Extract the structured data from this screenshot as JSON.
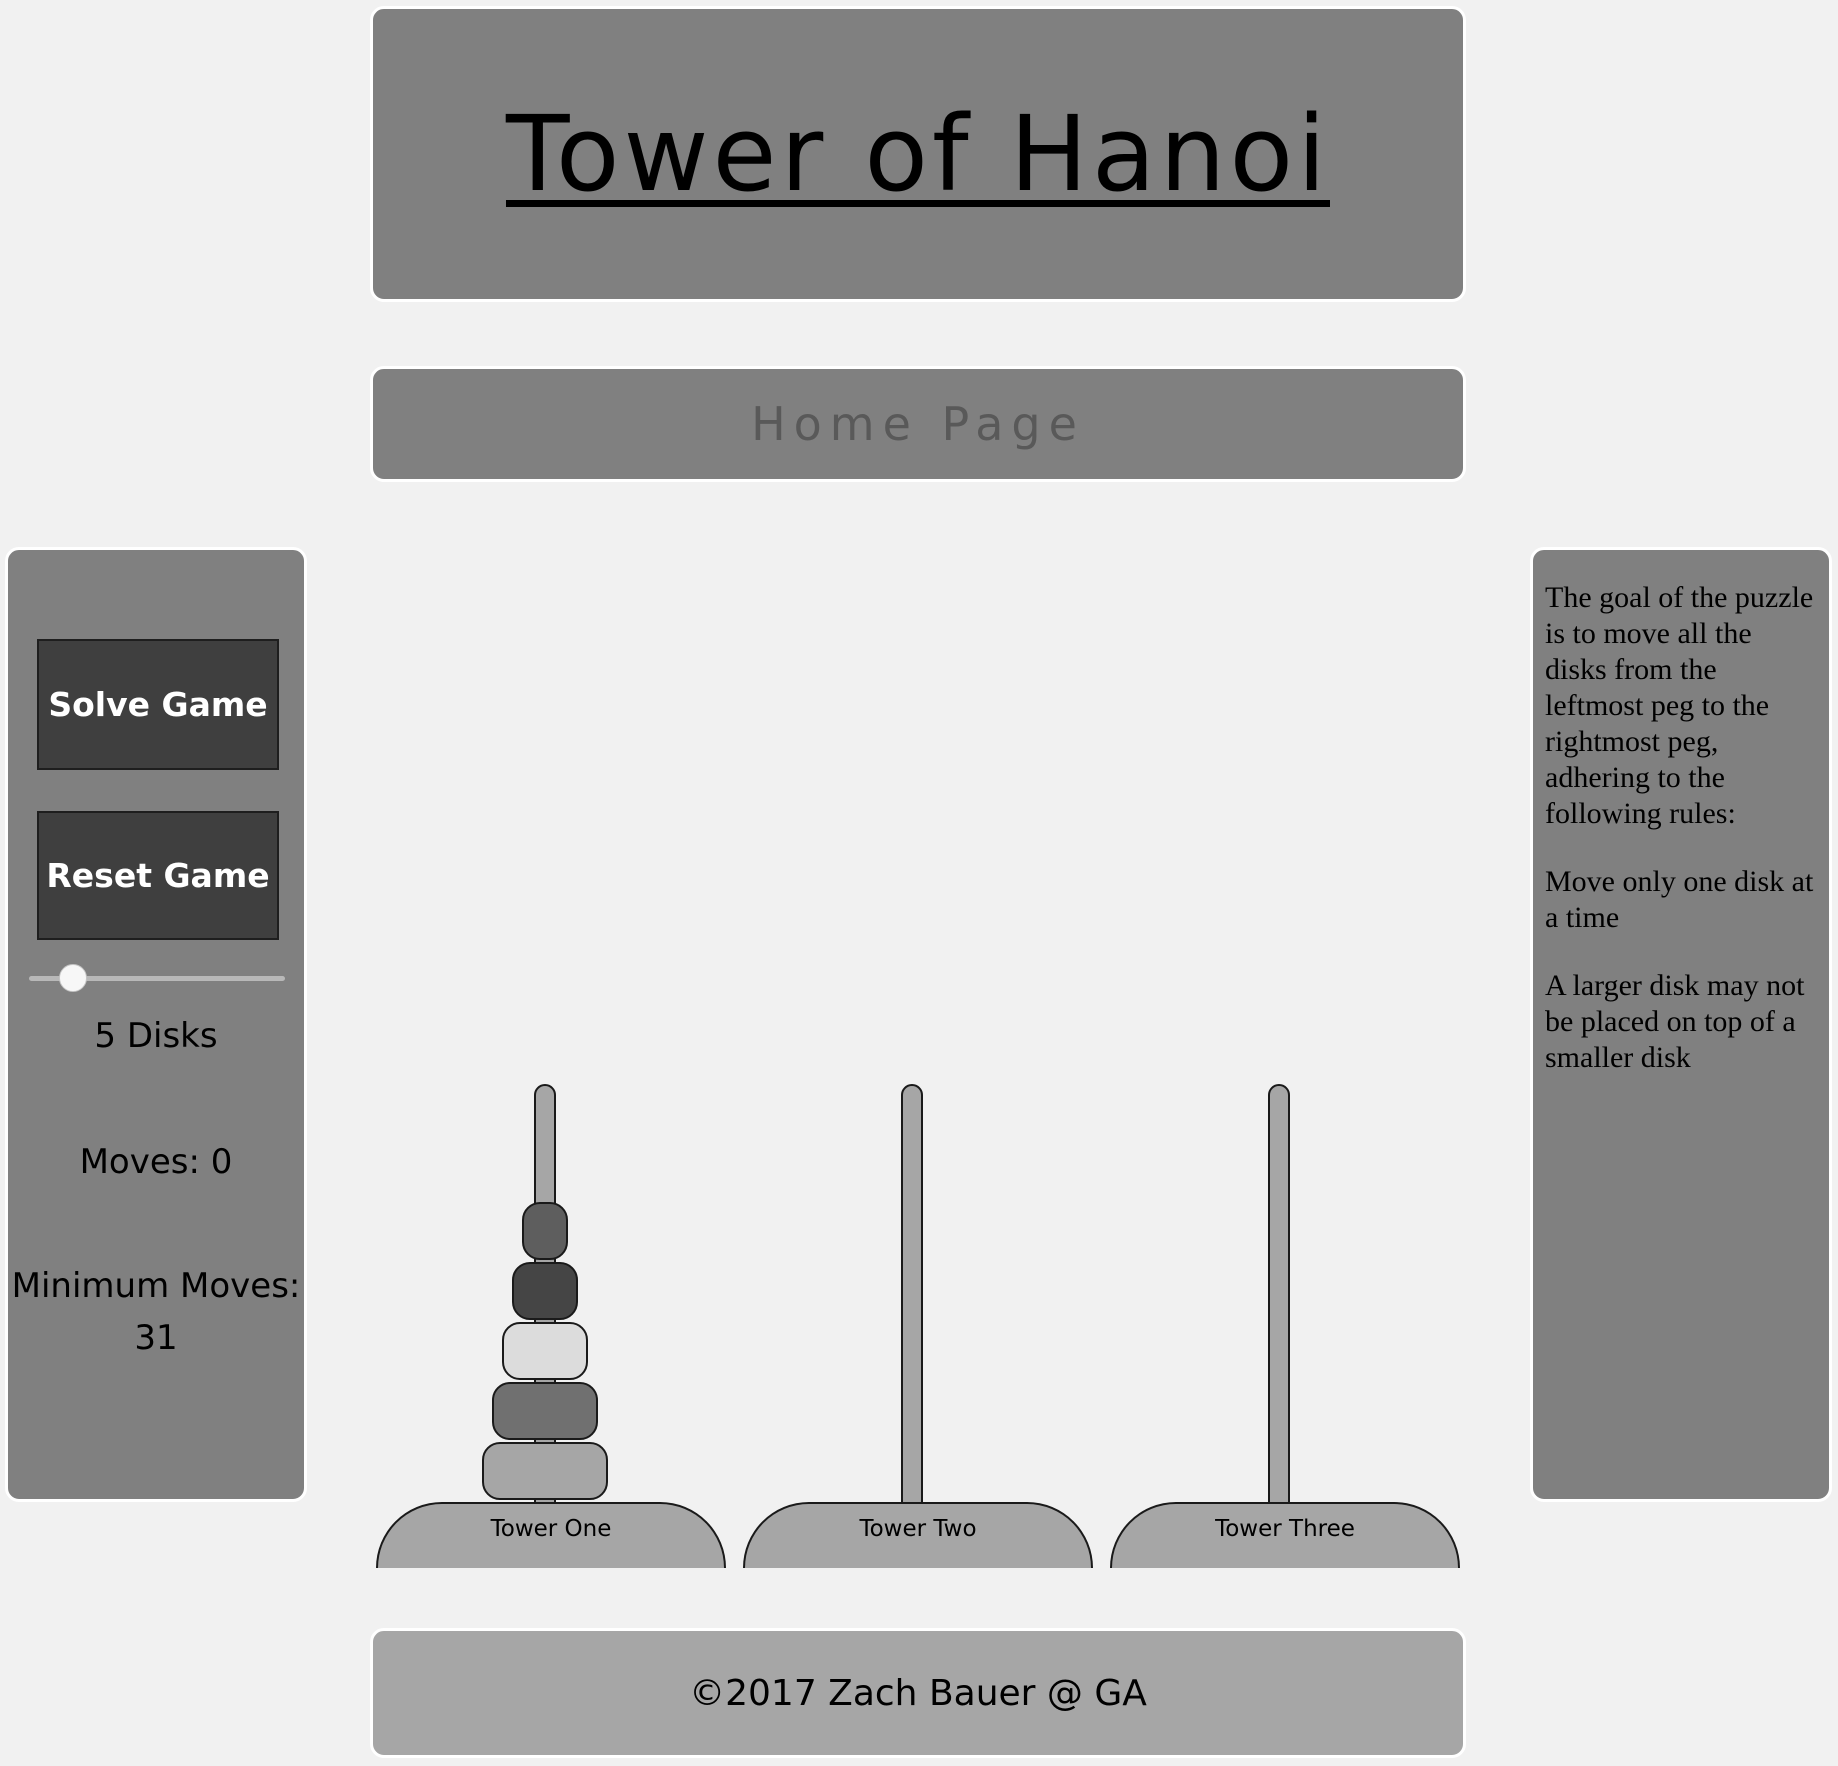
{
  "header": {
    "title": "Tower of Hanoi"
  },
  "nav": {
    "home_label": "Home Page"
  },
  "controls": {
    "solve_label": "Solve Game",
    "reset_label": "Reset Game",
    "slider": {
      "min": 3,
      "max": 8,
      "value": 3
    },
    "disk_count_text": "5 Disks",
    "moves_text": "Moves: 0",
    "min_moves_label": "Minimum Moves:",
    "min_moves_value": "31"
  },
  "rules": {
    "goal": "The goal of the puzzle is to move all the disks from the leftmost peg to the rightmost peg, adhering to the following rules:",
    "rule1": "Move only one disk at a time",
    "rule2": "A larger disk may not be placed on top of a smaller disk"
  },
  "towers": [
    {
      "name": "Tower One",
      "disks": [
        5,
        4,
        3,
        2,
        1
      ]
    },
    {
      "name": "Tower Two",
      "disks": []
    },
    {
      "name": "Tower Three",
      "disks": []
    }
  ],
  "disk_colors": {
    "1": "#5e5e5e",
    "2": "#454545",
    "3": "#dcdcdc",
    "4": "#707070",
    "5": "#a6a6a6"
  },
  "footer": {
    "copyright": "©2017 Zach Bauer @ GA"
  },
  "colors": {
    "background": "#f1f1f1",
    "panel": "#808080",
    "button": "#3f3f3f",
    "peg": "#a6a6a6",
    "footer": "#a6a6a6"
  }
}
